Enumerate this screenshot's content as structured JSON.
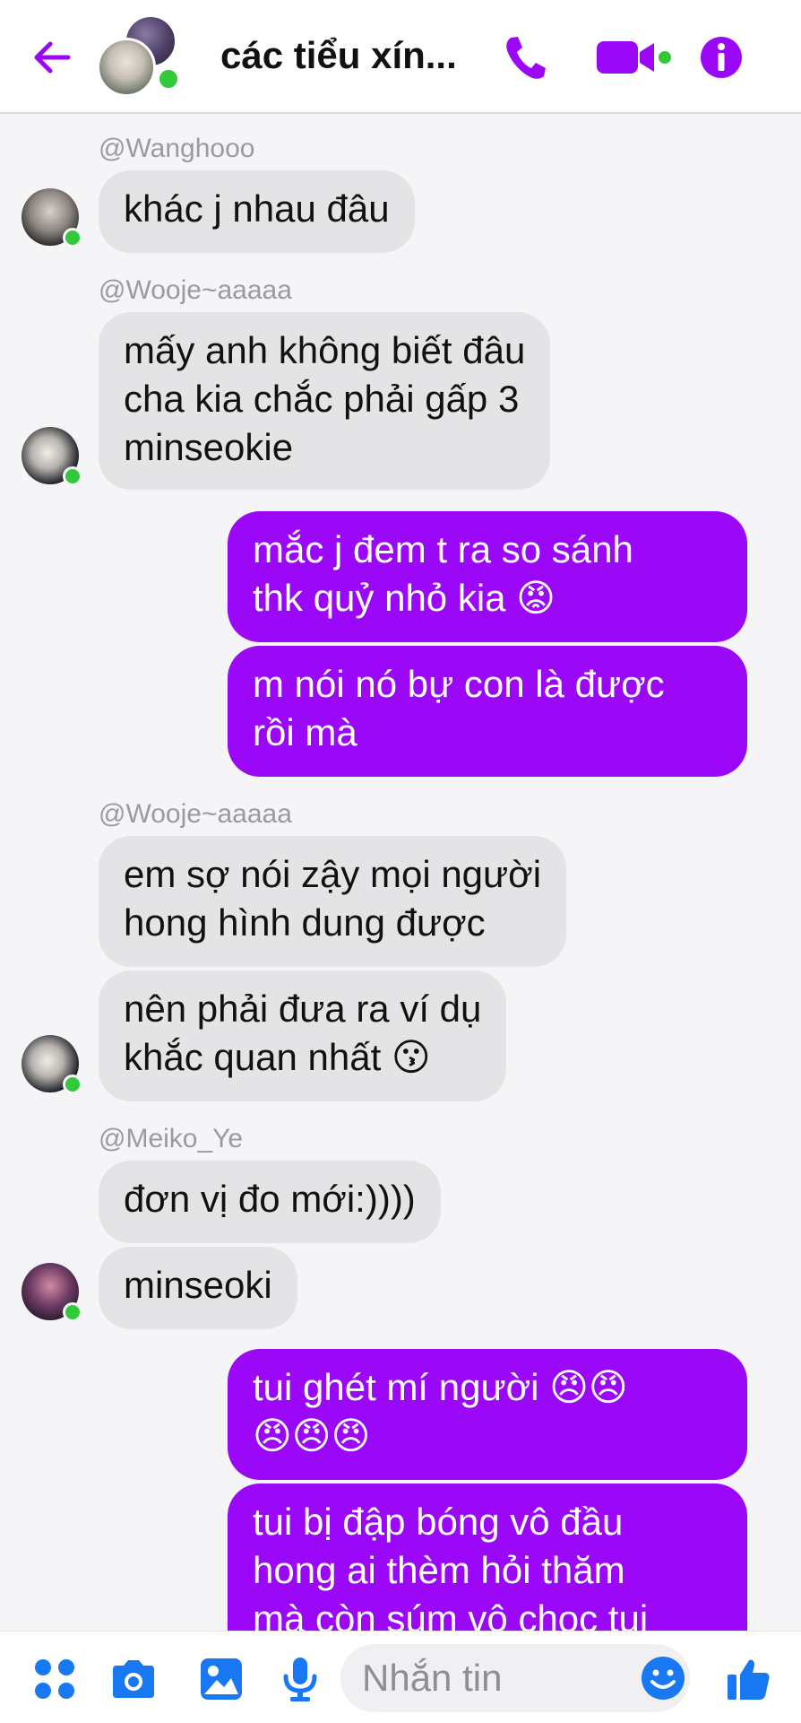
{
  "header": {
    "title": "các tiểu xín...",
    "accent_color": "#9b08f7",
    "icons": [
      "back-arrow-icon",
      "phone-icon",
      "video-camera-icon",
      "info-icon"
    ]
  },
  "messages": [
    {
      "type": "sender",
      "text": "@Wanghooo"
    },
    {
      "type": "in",
      "text": "khác j nhau đâu"
    },
    {
      "type": "sender",
      "text": "@Wooje~aaaaa"
    },
    {
      "type": "in",
      "text": "mấy anh không biết đâu\ncha kia chắc phải gấp 3\nminseokie"
    },
    {
      "type": "out",
      "text": "mắc j đem t ra so sánh\nthk quỷ nhỏ kia 😡"
    },
    {
      "type": "out",
      "text": "m nói nó bự con là được\nrồi mà"
    },
    {
      "type": "sender",
      "text": "@Wooje~aaaaa"
    },
    {
      "type": "in",
      "text": "em sợ nói zậy mọi người\nhong hình dung được"
    },
    {
      "type": "in",
      "text": "nên phải đưa ra ví dụ\nkhắc quan nhất 😗"
    },
    {
      "type": "sender",
      "text": "@Meiko_Ye"
    },
    {
      "type": "in",
      "text": "đơn vị đo mới:))))"
    },
    {
      "type": "in",
      "text": "minseoki"
    },
    {
      "type": "out",
      "text": "tui ghét mí người 😠😠\n😠😠😠"
    },
    {
      "type": "out",
      "text": "tui bị đập bóng vô đầu\nhong ai thèm hỏi thăm\nmà còn súm vô chọc tui"
    }
  ],
  "composer": {
    "placeholder": "Nhắn tin",
    "icons": [
      "apps-icon",
      "camera-icon",
      "gallery-icon",
      "microphone-icon",
      "emoji-icon",
      "thumbs-up-icon"
    ]
  }
}
